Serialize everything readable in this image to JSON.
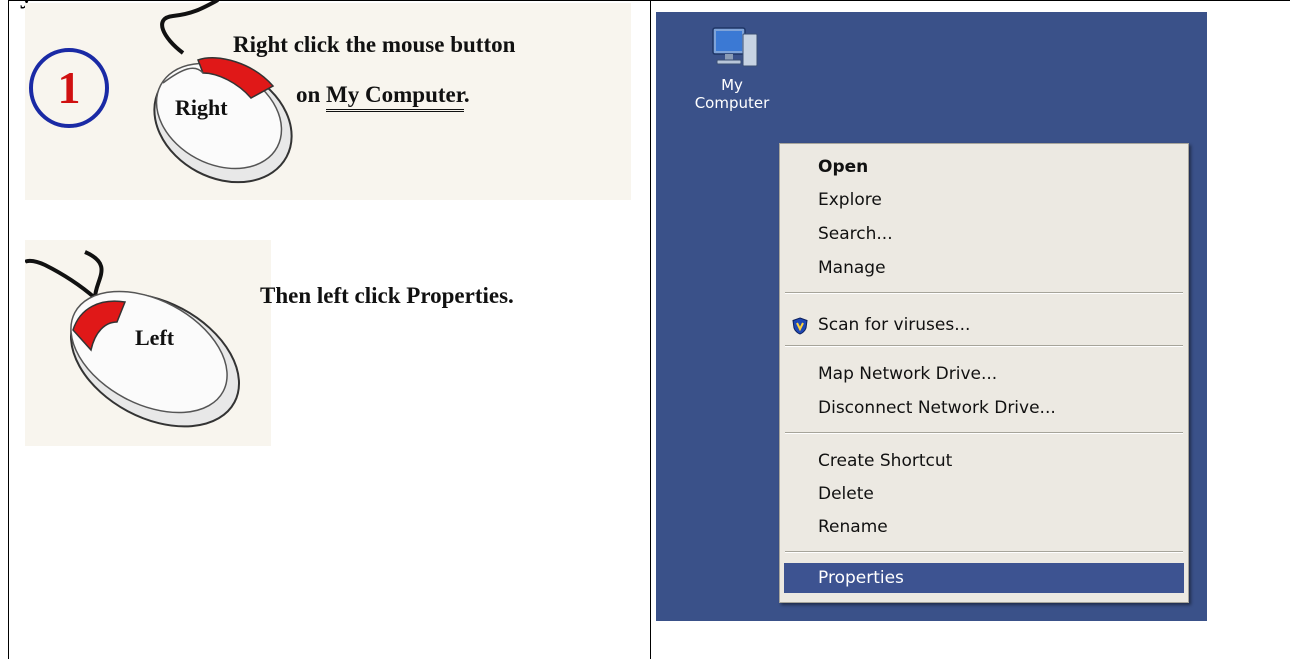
{
  "header": {
    "title_fragment": "y"
  },
  "step1": {
    "number": "1",
    "mouse_label": "Right",
    "instruction_line1": "Right click the mouse button",
    "instruction_line2_prefix": "on ",
    "instruction_link": "My Computer",
    "instruction_suffix": "."
  },
  "step2": {
    "mouse_label": "Left",
    "instruction": "Then left click Properties."
  },
  "desktop": {
    "icon_label_line1": "My",
    "icon_label_line2": "Computer",
    "background_color": "#3a5189"
  },
  "context_menu": {
    "items": [
      {
        "label": "Open",
        "bold": true
      },
      {
        "label": "Explore"
      },
      {
        "label": "Search..."
      },
      {
        "label": "Manage"
      },
      {
        "label": "Scan for viruses...",
        "icon": "shield-icon"
      },
      {
        "label": "Map Network Drive..."
      },
      {
        "label": "Disconnect Network Drive..."
      },
      {
        "label": "Create Shortcut"
      },
      {
        "label": "Delete"
      },
      {
        "label": "Rename"
      },
      {
        "label": "Properties",
        "highlighted": true
      }
    ],
    "highlight_color": "#3d5391"
  }
}
